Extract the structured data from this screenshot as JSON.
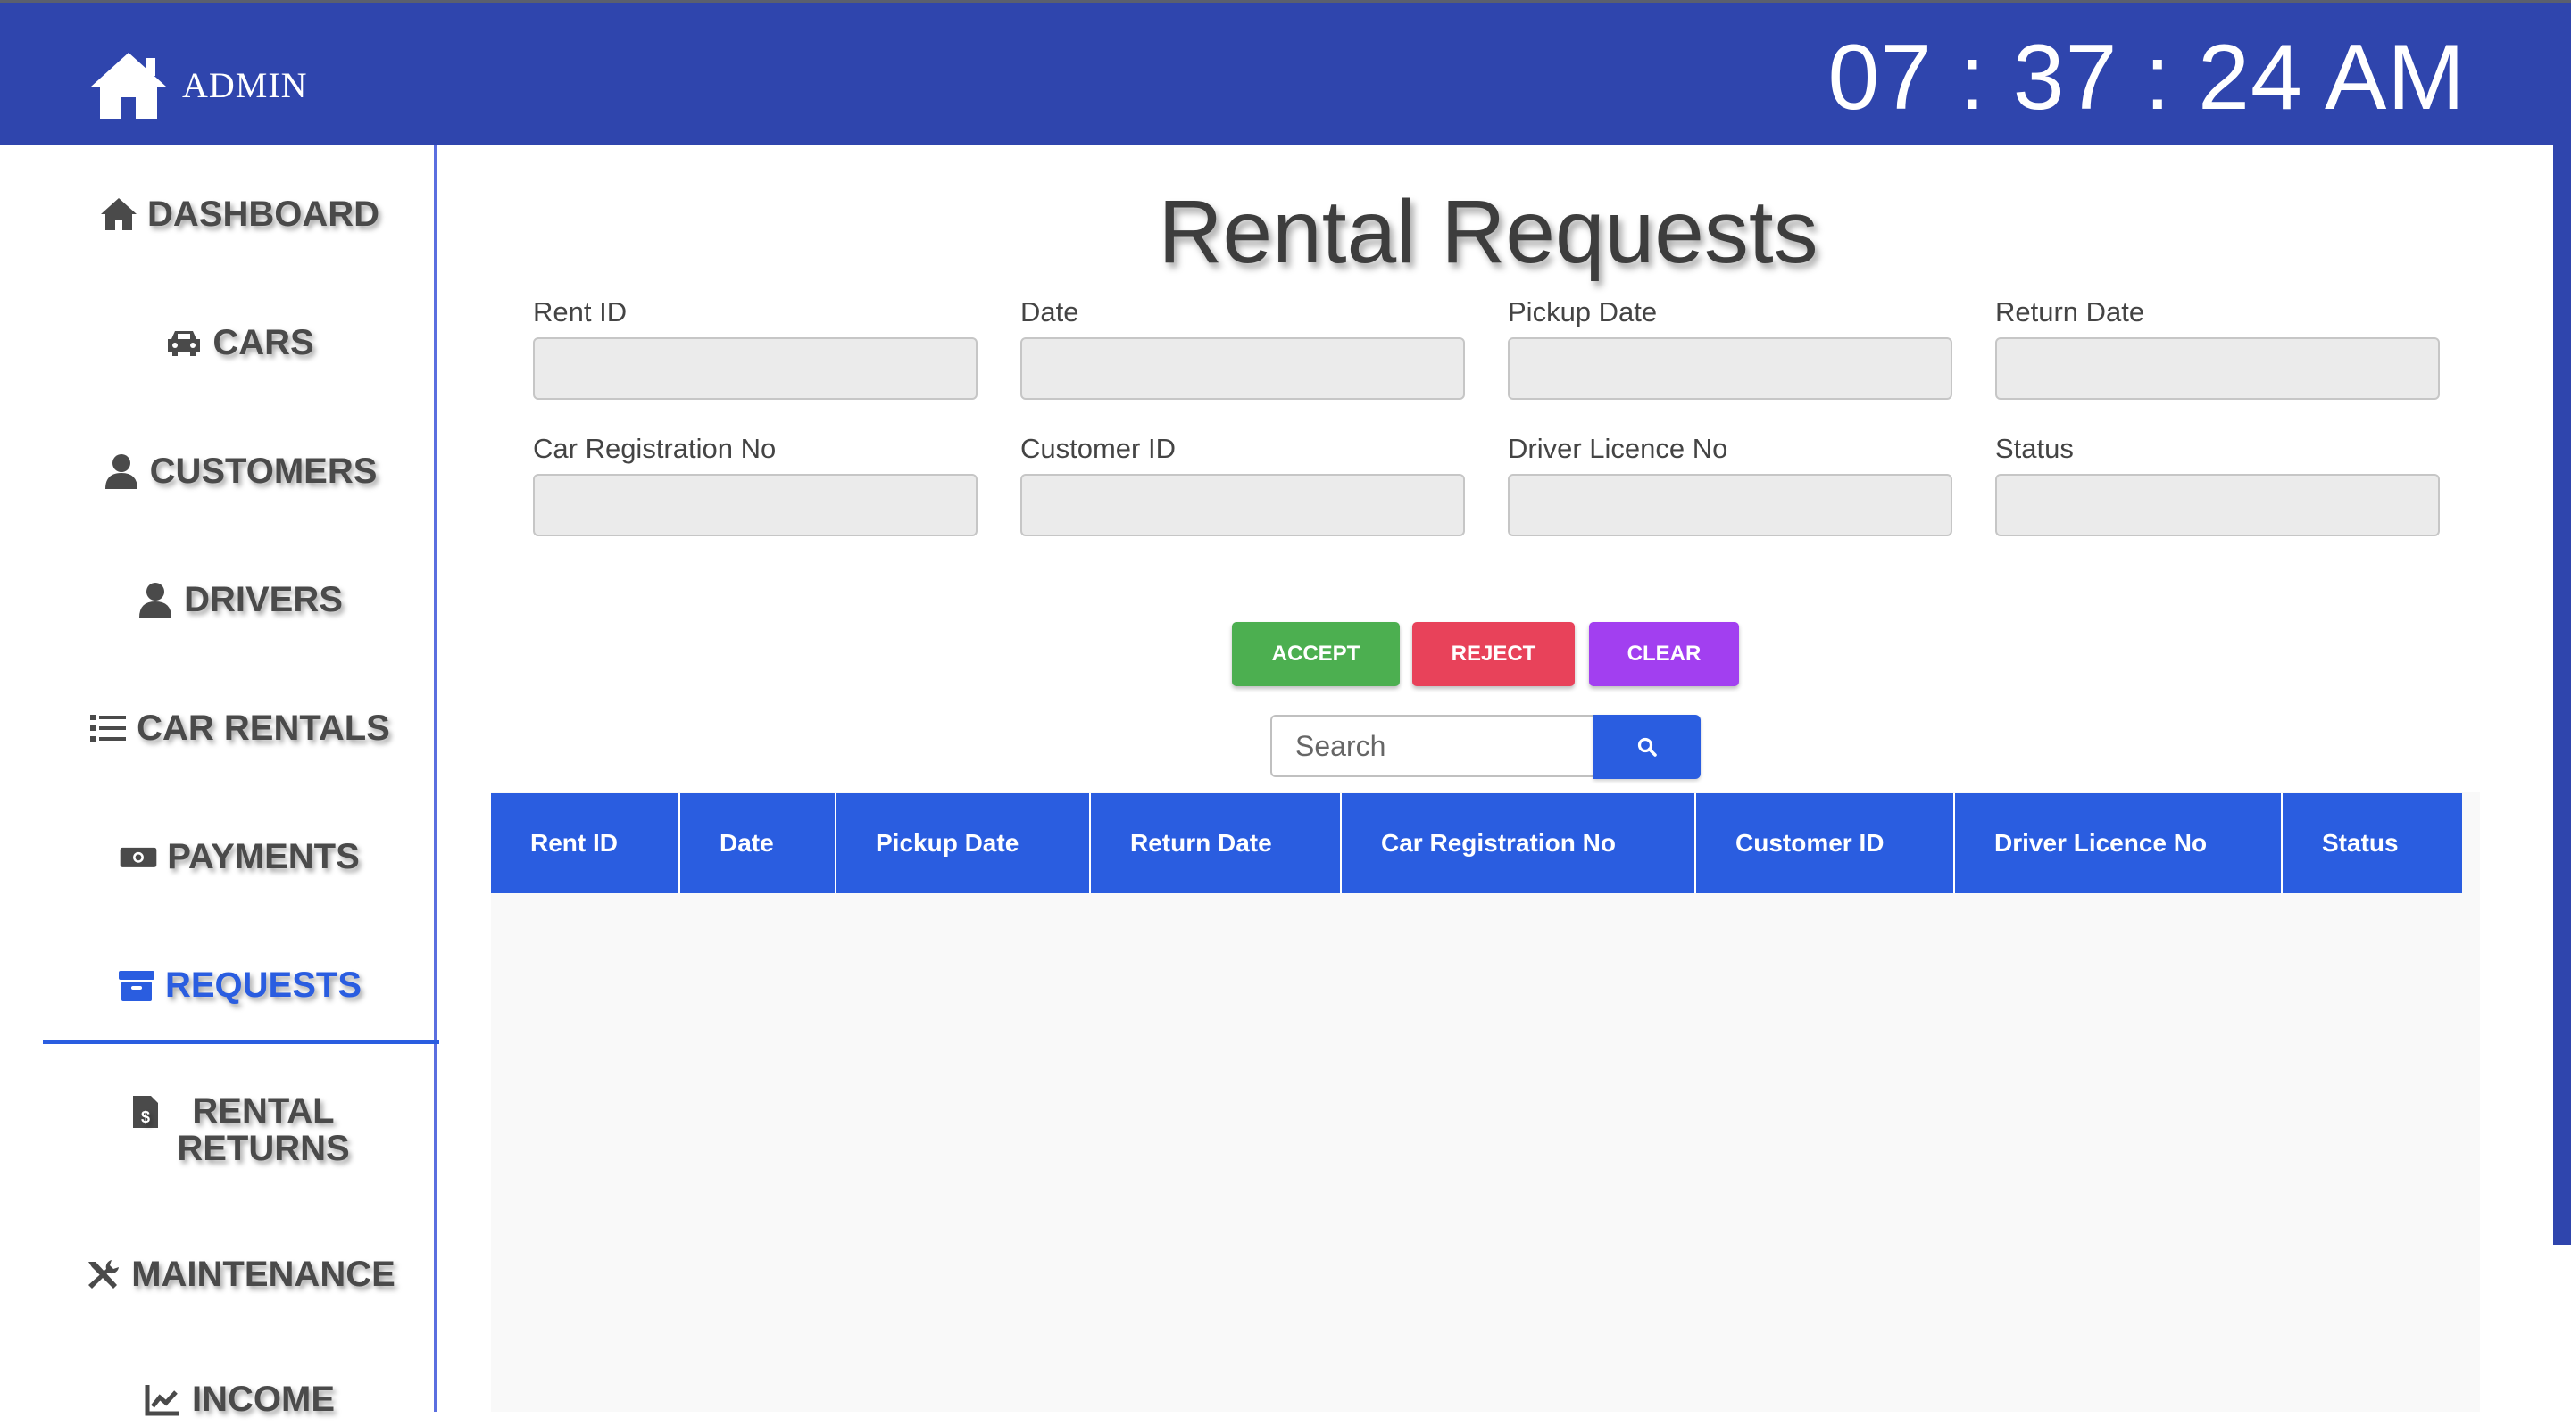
{
  "header": {
    "brand": "ADMIN",
    "clock": "07 : 37 : 24 AM",
    "brand_icon": "home-icon"
  },
  "sidebar": {
    "items": [
      {
        "label": "DASHBOARD",
        "icon": "home-icon"
      },
      {
        "label": "CARS",
        "icon": "car-icon"
      },
      {
        "label": "CUSTOMERS",
        "icon": "user-icon"
      },
      {
        "label": "DRIVERS",
        "icon": "user-icon"
      },
      {
        "label": "CAR RENTALS",
        "icon": "list-icon"
      },
      {
        "label": "PAYMENTS",
        "icon": "money-icon"
      },
      {
        "label": "REQUESTS",
        "icon": "archive-icon",
        "active": true
      },
      {
        "label": "RENTAL RETURNS",
        "icon": "invoice-icon"
      },
      {
        "label": "MAINTENANCE",
        "icon": "tools-icon"
      },
      {
        "label": "INCOME",
        "icon": "chart-icon"
      }
    ]
  },
  "main": {
    "title": "Rental Requests",
    "fields": [
      {
        "label": "Rent ID",
        "value": ""
      },
      {
        "label": "Date",
        "value": ""
      },
      {
        "label": "Pickup Date",
        "value": ""
      },
      {
        "label": "Return Date",
        "value": ""
      },
      {
        "label": "Car Registration No",
        "value": ""
      },
      {
        "label": "Customer ID",
        "value": ""
      },
      {
        "label": "Driver Licence No",
        "value": ""
      },
      {
        "label": "Status",
        "value": ""
      }
    ],
    "buttons": {
      "accept": "ACCEPT",
      "reject": "REJECT",
      "clear": "CLEAR"
    },
    "search": {
      "placeholder": "Search",
      "value": ""
    },
    "table": {
      "columns": [
        "Rent ID",
        "Date",
        "Pickup Date",
        "Return Date",
        "Car Registration No",
        "Customer ID",
        "Driver Licence No",
        "Status"
      ],
      "rows": []
    }
  },
  "colors": {
    "header_bg": "#2f45ad",
    "accent": "#2a5de0",
    "accept": "#4caf50",
    "reject": "#e8425a",
    "clear": "#a23ff0"
  }
}
